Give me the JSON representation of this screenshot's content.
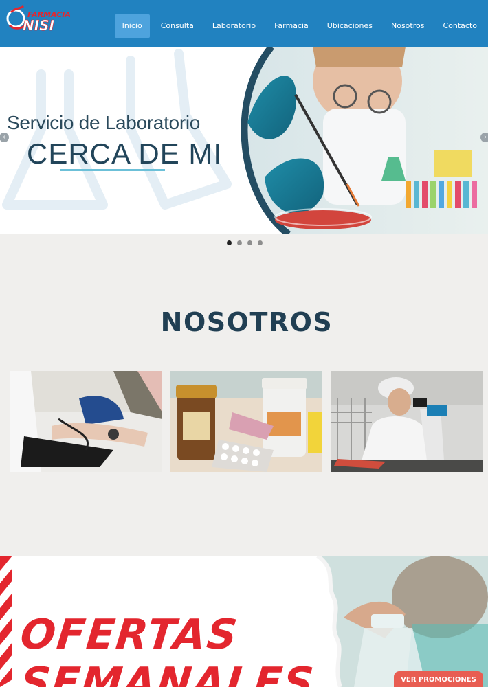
{
  "brand": {
    "name": "FARMACIA",
    "logo_text": "NISI",
    "accent": "#2182c0"
  },
  "nav": {
    "items": [
      {
        "label": "Inicio",
        "active": true
      },
      {
        "label": "Consulta"
      },
      {
        "label": "Laboratorio"
      },
      {
        "label": "Farmacia"
      },
      {
        "label": "Ubicaciones"
      },
      {
        "label": "Nosotros"
      },
      {
        "label": "Contacto"
      }
    ]
  },
  "hero": {
    "title": "Servicio de Laboratorio",
    "big_title": "CERCA DE MI",
    "prev_icon": "chevron-left-icon",
    "next_icon": "chevron-right-icon",
    "slides_count": 4,
    "active_slide": 1
  },
  "about": {
    "title": "NOSOTROS",
    "photos": [
      "blood-pressure-photo",
      "medicine-pills-photo",
      "microscope-lab-photo"
    ]
  },
  "promo": {
    "line1": "OFERTAS",
    "line2": "SEMANALES",
    "button_label": "VER PROMOCIONES",
    "color": "#e3262e"
  }
}
